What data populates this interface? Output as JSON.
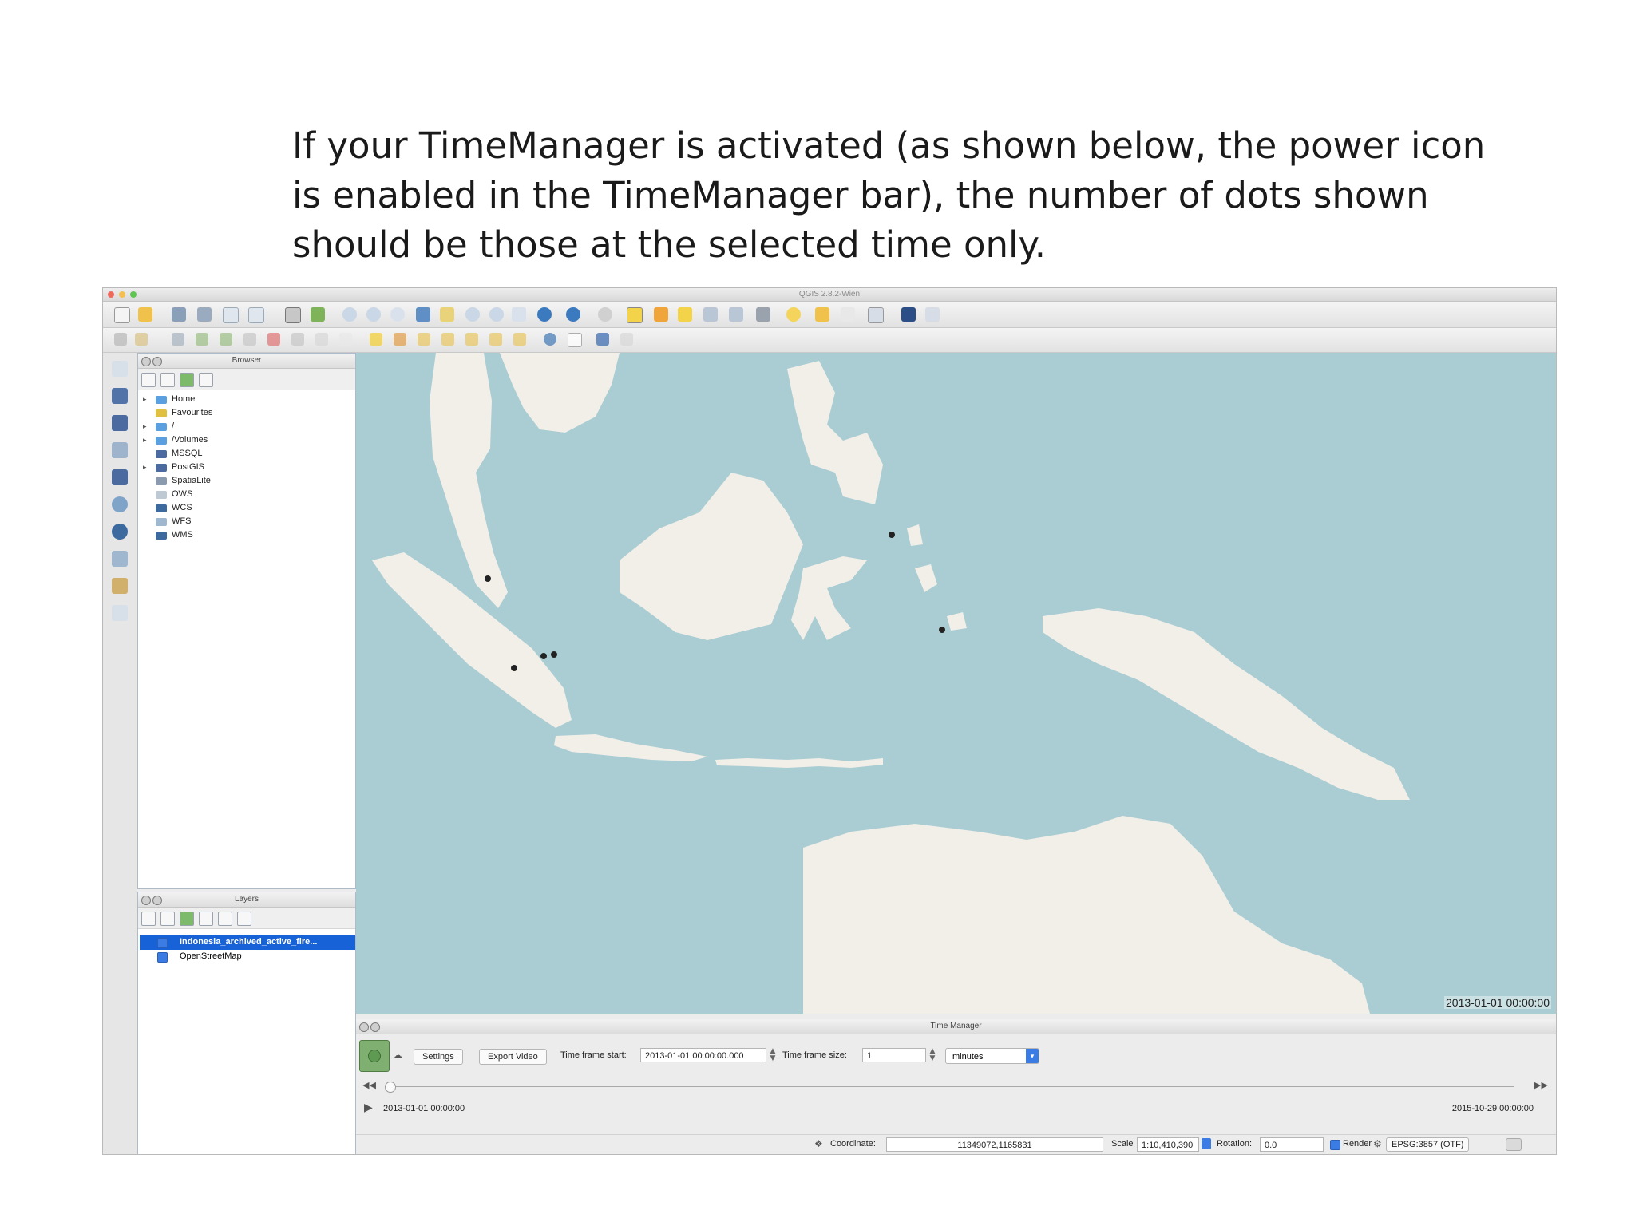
{
  "caption": {
    "line1": "If your TimeManager is activated (as shown below, the power icon",
    "line2": "is enabled in the TimeManager bar), the number of dots shown",
    "line3": "should be those at the selected time only."
  },
  "window": {
    "title": "QGIS 2.8.2-Wien",
    "traffic_colors": [
      "#ee6a5e",
      "#f5bf4f",
      "#61c554"
    ]
  },
  "browser": {
    "title": "Browser",
    "items": [
      {
        "label": "Home",
        "icon": "folder-icon",
        "expandable": true
      },
      {
        "label": "Favourites",
        "icon": "star-icon",
        "expandable": false
      },
      {
        "label": "/",
        "icon": "folder-icon",
        "expandable": true
      },
      {
        "label": "/Volumes",
        "icon": "folder-icon",
        "expandable": true
      },
      {
        "label": "MSSQL",
        "icon": "mssql-icon",
        "expandable": false
      },
      {
        "label": "PostGIS",
        "icon": "postgis-icon",
        "expandable": true
      },
      {
        "label": "SpatiaLite",
        "icon": "spatialite-icon",
        "expandable": false
      },
      {
        "label": "OWS",
        "icon": "ows-icon",
        "expandable": false
      },
      {
        "label": "WCS",
        "icon": "wcs-icon",
        "expandable": false
      },
      {
        "label": "WFS",
        "icon": "wfs-icon",
        "expandable": false
      },
      {
        "label": "WMS",
        "icon": "wms-icon",
        "expandable": false
      }
    ]
  },
  "layers": {
    "title": "Layers",
    "items": [
      {
        "label": "Indonesia_archived_active_fire...",
        "selected": true,
        "checked": true
      },
      {
        "label": "OpenStreetMap",
        "selected": false,
        "checked": true
      }
    ]
  },
  "map": {
    "timestamp": "2013-01-01 00:00:00",
    "colors": {
      "sea": "#aacdd3",
      "land": "#f2efe9"
    }
  },
  "time_manager": {
    "title": "Time Manager",
    "power_enabled": true,
    "settings_label": "Settings",
    "export_label": "Export Video",
    "frame_start_label": "Time frame start:",
    "frame_start_value": "2013-01-01 00:00:00.000",
    "frame_size_label": "Time frame size:",
    "frame_size_value": "1",
    "unit_value": "minutes",
    "start_date": "2013-01-01 00:00:00",
    "end_date": "2015-10-29 00:00:00",
    "slider_fraction": 0.0
  },
  "status_bar": {
    "coordinate_label": "Coordinate:",
    "coordinate_value": "11349072,1165831",
    "scale_label": "Scale",
    "scale_value": "1:10,410,390",
    "rotation_label": "Rotation:",
    "rotation_value": "0.0",
    "render_label": "Render",
    "crs_label": "EPSG:3857 (OTF)"
  }
}
